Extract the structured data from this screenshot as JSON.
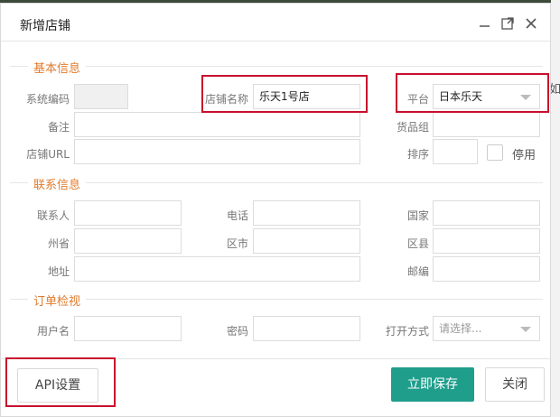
{
  "dialog": {
    "title": "新增店铺"
  },
  "sections": {
    "basic": "基本信息",
    "contact": "联系信息",
    "order": "订单检视"
  },
  "basic": {
    "system_code_label": "系统编码",
    "shop_name_label": "店铺名称",
    "shop_name_value": "乐天1号店",
    "platform_label": "平台",
    "platform_value": "日本乐天",
    "remark_label": "备注",
    "goods_group_label": "货品组",
    "shop_url_label": "店铺URL",
    "sort_label": "排序",
    "disable_label": "停用"
  },
  "contact": {
    "contact_person_label": "联系人",
    "phone_label": "电话",
    "country_label": "国家",
    "state_label": "州省",
    "district_label": "区市",
    "county_label": "区县",
    "address_label": "地址",
    "postcode_label": "邮编"
  },
  "order": {
    "username_label": "用户名",
    "password_label": "密码",
    "open_mode_label": "打开方式",
    "open_mode_placeholder": "请选择..."
  },
  "footer": {
    "api_settings": "API设置",
    "save_now": "立即保存",
    "close": "关闭"
  },
  "background": {
    "right_edge_text": "如"
  }
}
